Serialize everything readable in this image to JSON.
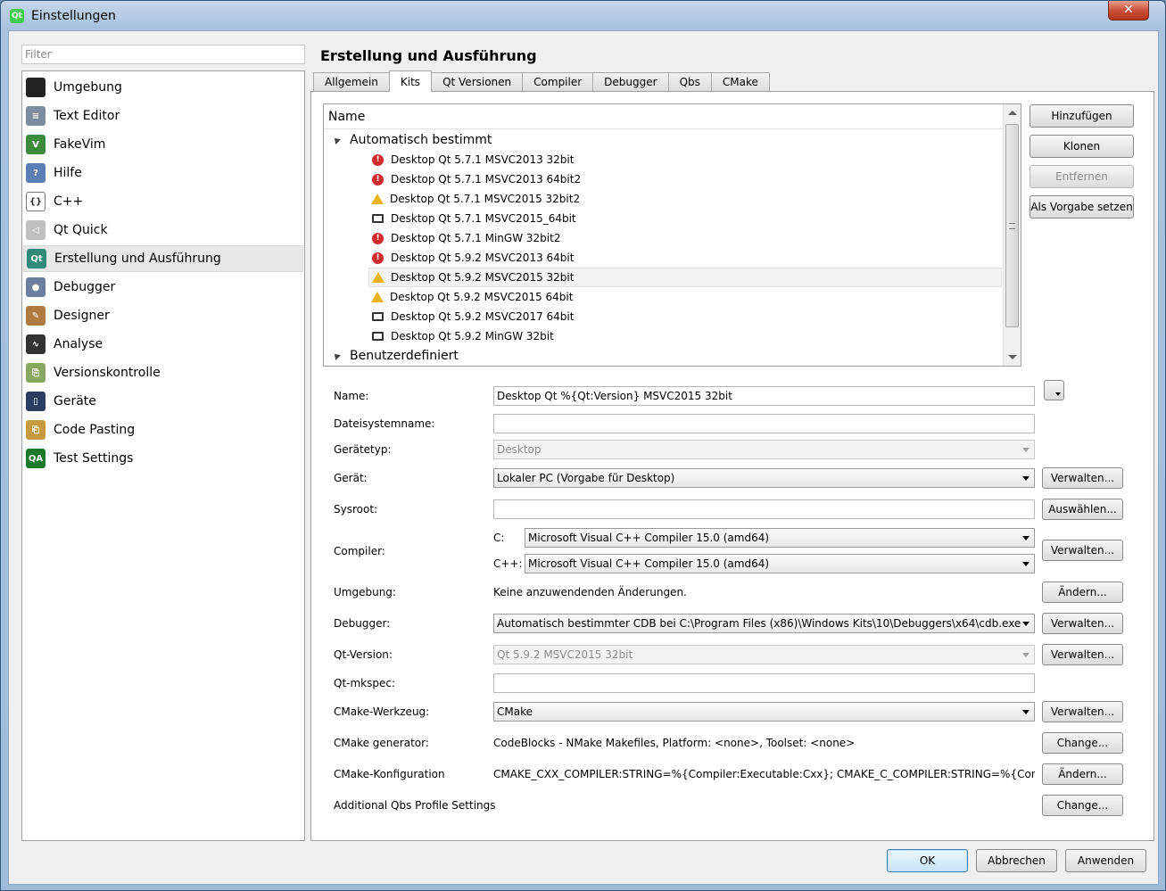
{
  "window": {
    "title": "Einstellungen",
    "close_label": "✕",
    "logo_label": "Qt"
  },
  "filter": {
    "placeholder": "Filter"
  },
  "sidebar": {
    "items": [
      {
        "label": "Umgebung",
        "icon": "monitor-icon",
        "color": "#222222",
        "glyph": ""
      },
      {
        "label": "Text Editor",
        "icon": "text-editor-icon",
        "color": "#7d8da0",
        "glyph": "≡"
      },
      {
        "label": "FakeVim",
        "icon": "fakevim-icon",
        "color": "#3c8a3c",
        "glyph": "V"
      },
      {
        "label": "Hilfe",
        "icon": "help-icon",
        "color": "#5b7fb5",
        "glyph": "?"
      },
      {
        "label": "C++",
        "icon": "cpp-braces-icon",
        "color": "#ffffff",
        "glyph": "{}"
      },
      {
        "label": "Qt Quick",
        "icon": "qt-quick-icon",
        "color": "#c0c0c0",
        "glyph": "◁"
      },
      {
        "label": "Erstellung und Ausführung",
        "icon": "build-run-icon",
        "color": "#2f8a78",
        "glyph": "Qt"
      },
      {
        "label": "Debugger",
        "icon": "debugger-icon",
        "color": "#6a7f9c",
        "glyph": "●"
      },
      {
        "label": "Designer",
        "icon": "designer-icon",
        "color": "#b07a40",
        "glyph": "✎"
      },
      {
        "label": "Analyse",
        "icon": "analyse-icon",
        "color": "#333333",
        "glyph": "∿"
      },
      {
        "label": "Versionskontrolle",
        "icon": "version-control-icon",
        "color": "#88a860",
        "glyph": "⎘"
      },
      {
        "label": "Geräte",
        "icon": "devices-icon",
        "color": "#2a3f60",
        "glyph": "▯"
      },
      {
        "label": "Code Pasting",
        "icon": "code-pasting-icon",
        "color": "#c89a40",
        "glyph": "⎗"
      },
      {
        "label": "Test Settings",
        "icon": "test-settings-icon",
        "color": "#1a7a2a",
        "glyph": "QA"
      }
    ]
  },
  "main": {
    "title": "Erstellung und Ausführung"
  },
  "tabs": [
    "Allgemein",
    "Kits",
    "Qt Versionen",
    "Compiler",
    "Debugger",
    "Qbs",
    "CMake"
  ],
  "kits": {
    "header": "Name",
    "group_auto": "Automatisch bestimmt",
    "group_user": "Benutzerdefiniert",
    "rows": [
      {
        "label": "Desktop Qt 5.7.1 MSVC2013 32bit",
        "status": "error"
      },
      {
        "label": "Desktop Qt 5.7.1 MSVC2013 64bit2",
        "status": "error"
      },
      {
        "label": "Desktop Qt 5.7.1 MSVC2015 32bit2",
        "status": "warning"
      },
      {
        "label": "Desktop Qt 5.7.1 MSVC2015_64bit",
        "status": "desktop"
      },
      {
        "label": "Desktop Qt 5.7.1 MinGW 32bit2",
        "status": "error"
      },
      {
        "label": "Desktop Qt 5.9.2 MSVC2013 64bit",
        "status": "error"
      },
      {
        "label": "Desktop Qt 5.9.2 MSVC2015 32bit",
        "status": "warning"
      },
      {
        "label": "Desktop Qt 5.9.2 MSVC2015 64bit",
        "status": "warning"
      },
      {
        "label": "Desktop Qt 5.9.2 MSVC2017 64bit",
        "status": "desktop"
      },
      {
        "label": "Desktop Qt 5.9.2 MinGW 32bit",
        "status": "desktop"
      }
    ],
    "buttons": {
      "add": "Hinzufügen",
      "clone": "Klonen",
      "remove": "Entfernen",
      "default": "Als Vorgabe setzen"
    }
  },
  "form": {
    "name_label": "Name:",
    "name_value": "Desktop Qt %{Qt:Version} MSVC2015 32bit",
    "fsname_label": "Dateisystemname:",
    "fsname_value": "",
    "devtype_label": "Gerätetyp:",
    "devtype_value": "Desktop",
    "device_label": "Gerät:",
    "device_value": "Lokaler PC (Vorgabe für Desktop)",
    "sysroot_label": "Sysroot:",
    "sysroot_value": "",
    "compiler_label": "Compiler:",
    "c_label": "C:",
    "c_value": "Microsoft Visual C++ Compiler 15.0 (amd64)",
    "cpp_label": "C++:",
    "cpp_value": "Microsoft Visual C++ Compiler 15.0 (amd64)",
    "env_label": "Umgebung:",
    "env_value": "Keine anzuwendenden Änderungen.",
    "debugger_label": "Debugger:",
    "debugger_value": "Automatisch bestimmter CDB bei C:\\Program Files (x86)\\Windows Kits\\10\\Debuggers\\x64\\cdb.exe",
    "qtver_label": "Qt-Version:",
    "qtver_value": "Qt 5.9.2 MSVC2015 32bit",
    "mkspec_label": "Qt-mkspec:",
    "mkspec_value": "",
    "cmake_tool_label": "CMake-Werkzeug:",
    "cmake_tool_value": "CMake",
    "cmake_gen_label": "CMake generator:",
    "cmake_gen_value": "CodeBlocks - NMake Makefiles, Platform: <none>, Toolset: <none>",
    "cmake_conf_label": "CMake-Konfiguration",
    "cmake_conf_value": "CMAKE_CXX_COMPILER:STRING=%{Compiler:Executable:Cxx}; CMAKE_C_COMPILER:STRING=%{Com...",
    "qbs_label": "Additional Qbs Profile Settings",
    "btn_manage": "Verwalten...",
    "btn_browse": "Auswählen...",
    "btn_change_de": "Ändern...",
    "btn_change_en": "Change..."
  },
  "dialog": {
    "ok": "OK",
    "cancel": "Abbrechen",
    "apply": "Anwenden"
  }
}
